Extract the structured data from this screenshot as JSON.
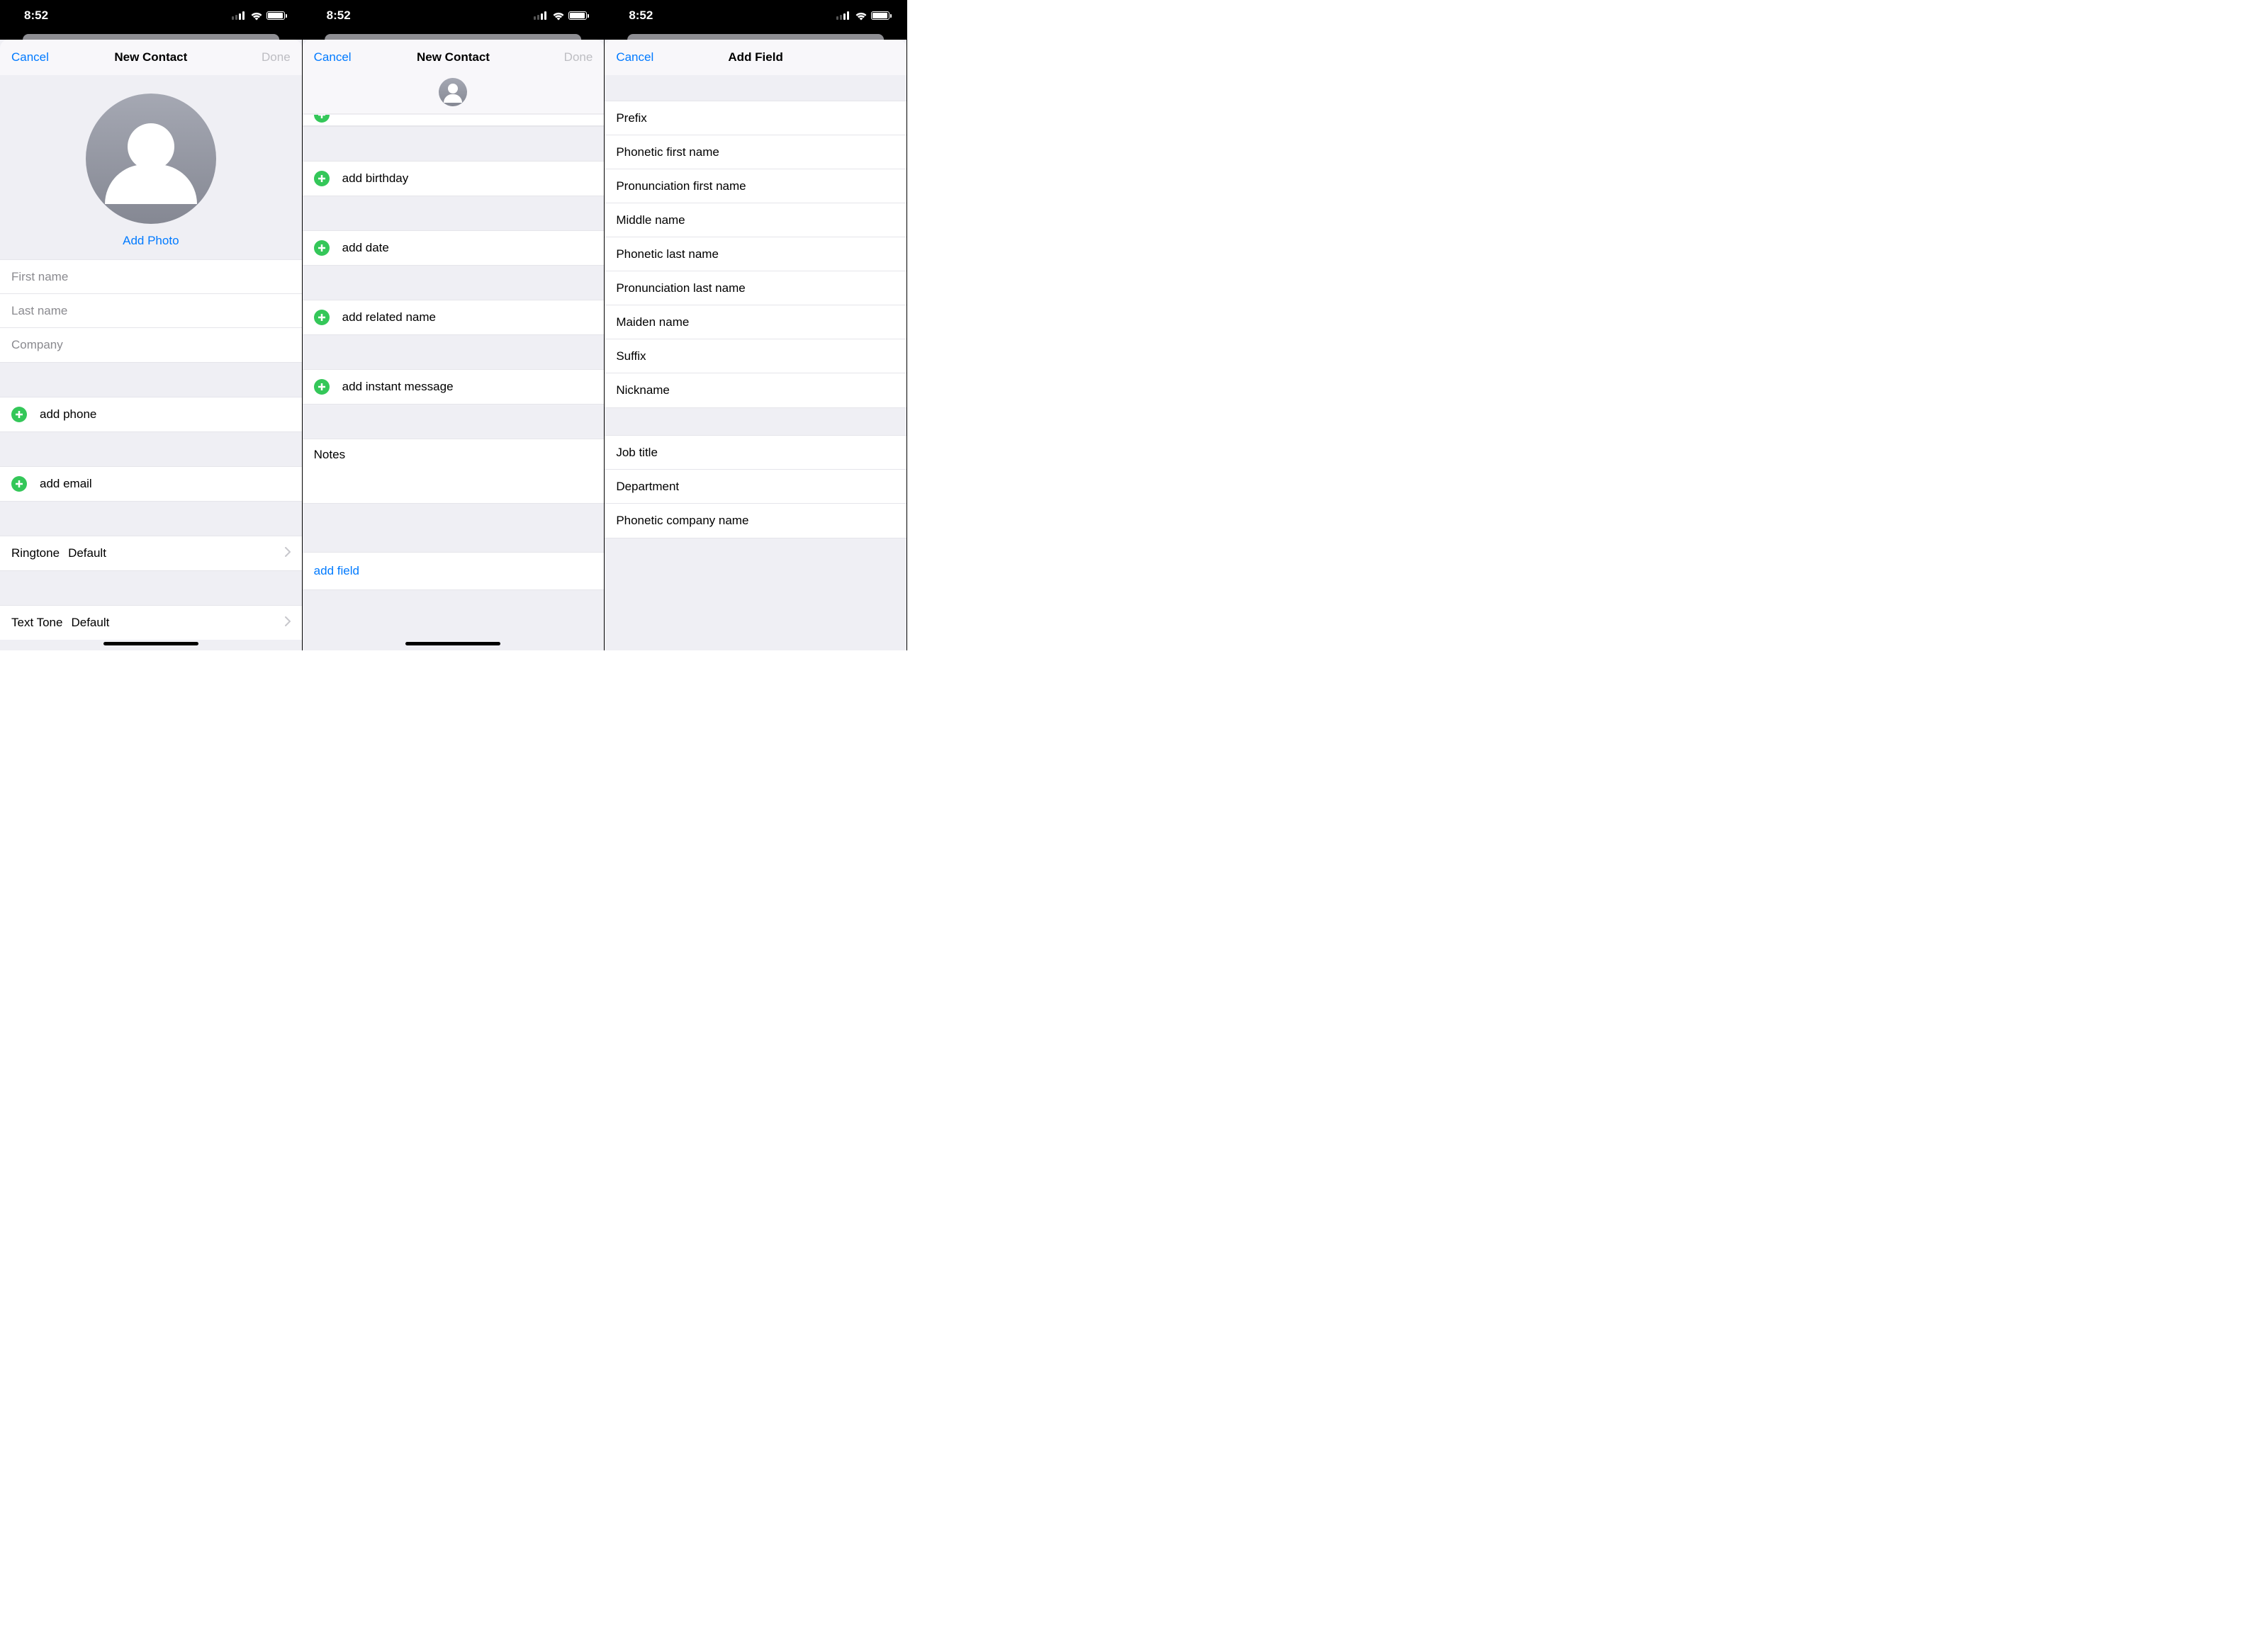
{
  "status": {
    "time": "8:52"
  },
  "p1": {
    "nav": {
      "cancel": "Cancel",
      "title": "New Contact",
      "done": "Done"
    },
    "addPhoto": "Add Photo",
    "fields": {
      "first": "First name",
      "last": "Last name",
      "company": "Company"
    },
    "addPhone": "add phone",
    "addEmail": "add email",
    "ringtone": {
      "label": "Ringtone",
      "value": "Default"
    },
    "texttone": {
      "label": "Text Tone",
      "value": "Default"
    }
  },
  "p2": {
    "nav": {
      "cancel": "Cancel",
      "title": "New Contact",
      "done": "Done"
    },
    "addBirthday": "add birthday",
    "addDate": "add date",
    "addRelated": "add related name",
    "addIM": "add instant message",
    "notesLabel": "Notes",
    "addField": "add field"
  },
  "p3": {
    "nav": {
      "cancel": "Cancel",
      "title": "Add Field"
    },
    "group1": [
      "Prefix",
      "Phonetic first name",
      "Pronunciation first name",
      "Middle name",
      "Phonetic last name",
      "Pronunciation last name",
      "Maiden name",
      "Suffix",
      "Nickname"
    ],
    "group2": [
      "Job title",
      "Department",
      "Phonetic company name"
    ]
  }
}
